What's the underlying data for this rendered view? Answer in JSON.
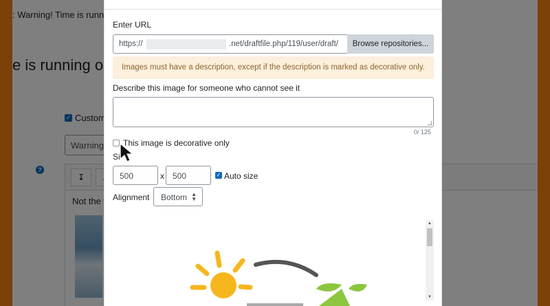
{
  "background": {
    "banner_text": ": Warning! Time is running",
    "page_title": "e is running ou",
    "custom_label": "Custom",
    "input_value": "Warning!",
    "editor_text": "Not the w"
  },
  "dialog": {
    "url_label": "Enter URL",
    "url_prefix": "https://",
    "url_suffix": ".net/draftfile.php/119/user/draft/",
    "browse_label": "Browse repositories...",
    "alert_text": "Images must have a description, except if the description is marked as decorative only.",
    "describe_label": "Describe this image for someone who cannot see it",
    "char_counter": "0/ 125",
    "decorative_label": "This image is decorative only",
    "size_label_partial": "Si",
    "width_value": "500",
    "times_sign": "x",
    "height_value": "500",
    "auto_size_label": "Auto size",
    "alignment_label": "Alignment",
    "alignment_value": "Bottom"
  },
  "colors": {
    "frame": "#f98012",
    "accent": "#0f6cbf",
    "alert_bg": "#fcefdc",
    "alert_text": "#8e662e"
  },
  "icons": {
    "help": "question-circle-icon",
    "cursor": "mouse-pointer-icon",
    "sun": "sun-illustration",
    "leaf": "leaf-illustration"
  }
}
